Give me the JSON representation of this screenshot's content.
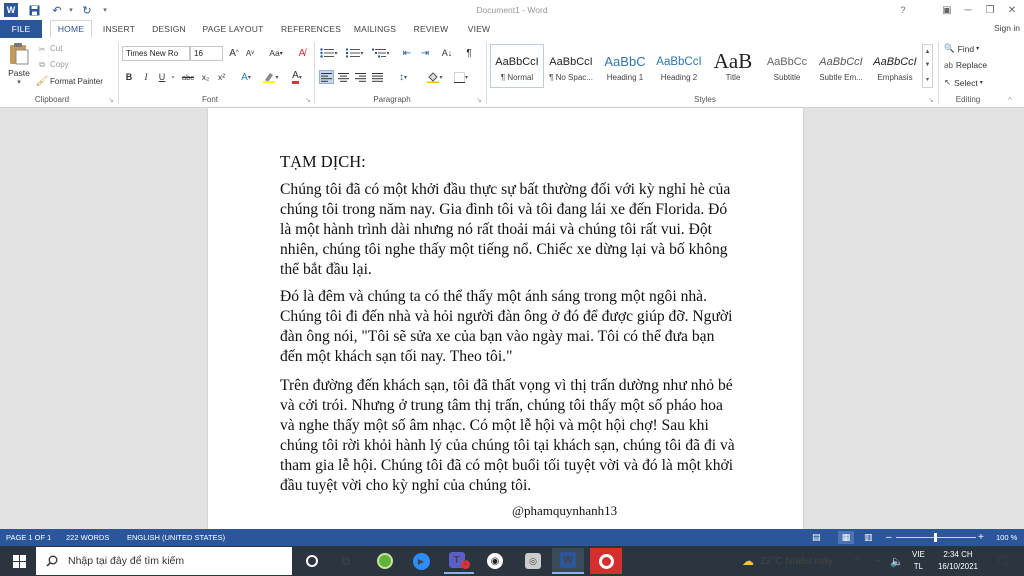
{
  "window": {
    "title": "Document1 - Word",
    "help": "?",
    "minimize": "─",
    "restore": "❐",
    "close": "✕",
    "sign_in": "Sign in"
  },
  "quick_access": {
    "save": "💾",
    "undo": "↶",
    "redo": "↻",
    "customize": "▾"
  },
  "tabs": [
    "FILE",
    "HOME",
    "INSERT",
    "DESIGN",
    "PAGE LAYOUT",
    "REFERENCES",
    "MAILINGS",
    "REVIEW",
    "VIEW"
  ],
  "ribbon": {
    "clipboard": {
      "paste": "Paste",
      "cut": "Cut",
      "copy": "Copy",
      "format_painter": "Format Painter",
      "label": "Clipboard"
    },
    "font": {
      "name": "Times New Ro",
      "size": "16",
      "grow": "A",
      "shrink": "A",
      "case": "Aa",
      "bold": "B",
      "italic": "I",
      "underline": "U",
      "strike": "abc",
      "sub": "x₂",
      "sup": "x²",
      "label": "Font"
    },
    "paragraph": {
      "label": "Paragraph",
      "show_marks": "¶"
    },
    "styles": {
      "label": "Styles",
      "items": [
        {
          "preview": "AaBbCcI",
          "name": "¶ Normal"
        },
        {
          "preview": "AaBbCcI",
          "name": "¶ No Spac..."
        },
        {
          "preview": "AaBbC",
          "name": "Heading 1"
        },
        {
          "preview": "AaBbCcI",
          "name": "Heading 2"
        },
        {
          "preview": "AaB",
          "name": "Title"
        },
        {
          "preview": "AaBbCc",
          "name": "Subtitle"
        },
        {
          "preview": "AaBbCcI",
          "name": "Subtle Em..."
        },
        {
          "preview": "AaBbCcI",
          "name": "Emphasis"
        }
      ]
    },
    "editing": {
      "find": "Find",
      "replace": "Replace",
      "select": "Select",
      "label": "Editing"
    }
  },
  "document": {
    "heading": "TẠM DỊCH:",
    "paragraphs": [
      "Chúng tôi đã có một khởi đầu thực sự bất thường đối với kỳ nghỉ hè của chúng tôi trong năm nay. Gia đình tôi và tôi đang lái xe đến Florida. Đó là một hành trình dài nhưng nó rất thoải mái và chúng tôi rất vui. Đột nhiên, chúng tôi nghe thấy một tiếng nổ. Chiếc xe dừng lại và bố không thể bắt đầu lại.",
      "Đó là đêm và chúng ta có thể thấy một ánh sáng trong một ngôi nhà. Chúng tôi đi đến nhà và hỏi người đàn ông ở đó để được giúp đỡ. Người đàn ông nói, \"Tôi sẽ sửa xe của bạn vào ngày mai. Tôi có thể đưa bạn đến một khách sạn tối nay. Theo tôi.\"",
      "Trên đường đến khách sạn, tôi đã thất vọng vì thị trấn dường như nhỏ bé và cởi trói. Nhưng ở trung tâm thị trấn, chúng tôi thấy một số pháo hoa và nghe thấy một số âm nhạc. Có một lễ hội và một hội chợ! Sau khi chúng tôi rời khỏi hành lý của chúng tôi tại khách sạn, chúng tôi đã đi và tham gia lễ hội. Chúng tôi đã có một buổi tối tuyệt vời và đó là một khởi đầu tuyệt vời cho kỳ nghỉ của chúng tôi."
    ],
    "signature": "@phamquynhanh13"
  },
  "status": {
    "page": "PAGE 1 OF 1",
    "words": "222 WORDS",
    "language": "ENGLISH (UNITED STATES)",
    "zoom": "100 %",
    "zoom_minus": "–",
    "zoom_plus": "+"
  },
  "taskbar": {
    "search_placeholder": "Nhập tại đây để tìm kiếm",
    "weather": "22°C  Nhiều mây",
    "lang1": "VIE",
    "lang2": "TL",
    "time": "2:34 CH",
    "date": "16/10/2021"
  }
}
